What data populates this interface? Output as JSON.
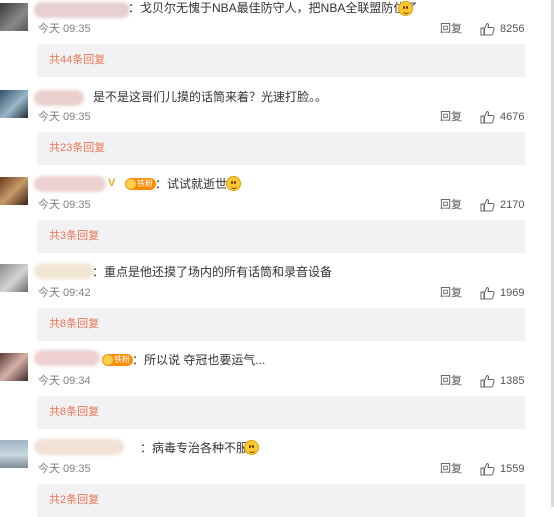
{
  "comments": [
    {
      "text": "：戈贝尔无愧于NBA最佳防守人，把NBA全联盟防住了",
      "time": "今天 09:35",
      "reply_label": "回复",
      "likes": "8256",
      "replies_label": "共44条回复"
    },
    {
      "text": "是不是这哥们儿摸的话筒来着？光速打脸。。",
      "time": "今天 09:35",
      "reply_label": "回复",
      "likes": "4676",
      "replies_label": "共23条回复"
    },
    {
      "text": "：试试就逝世",
      "badge": "铁粉",
      "time": "今天 09:35",
      "reply_label": "回复",
      "likes": "2170",
      "replies_label": "共3条回复"
    },
    {
      "text": "：重点是他还摸了场内的所有话筒和录音设备",
      "time": "今天 09:42",
      "reply_label": "回复",
      "likes": "1969",
      "replies_label": "共8条回复"
    },
    {
      "text": "：所以说 夺冠也要运气...",
      "badge": "铁粉",
      "time": "今天 09:34",
      "reply_label": "回复",
      "likes": "1385",
      "replies_label": "共8条回复"
    },
    {
      "text": "：病毒专治各种不服",
      "time": "今天 09:35",
      "reply_label": "回复",
      "likes": "1559",
      "replies_label": "共2条回复"
    }
  ],
  "colors": {
    "reply_link": "#eb7350",
    "reply_box_bg": "#f2f2f5",
    "meta_gray": "#808080"
  },
  "icons": {
    "like": "thumbs-up-icon",
    "emoji": "smiley-emoji-icon"
  }
}
